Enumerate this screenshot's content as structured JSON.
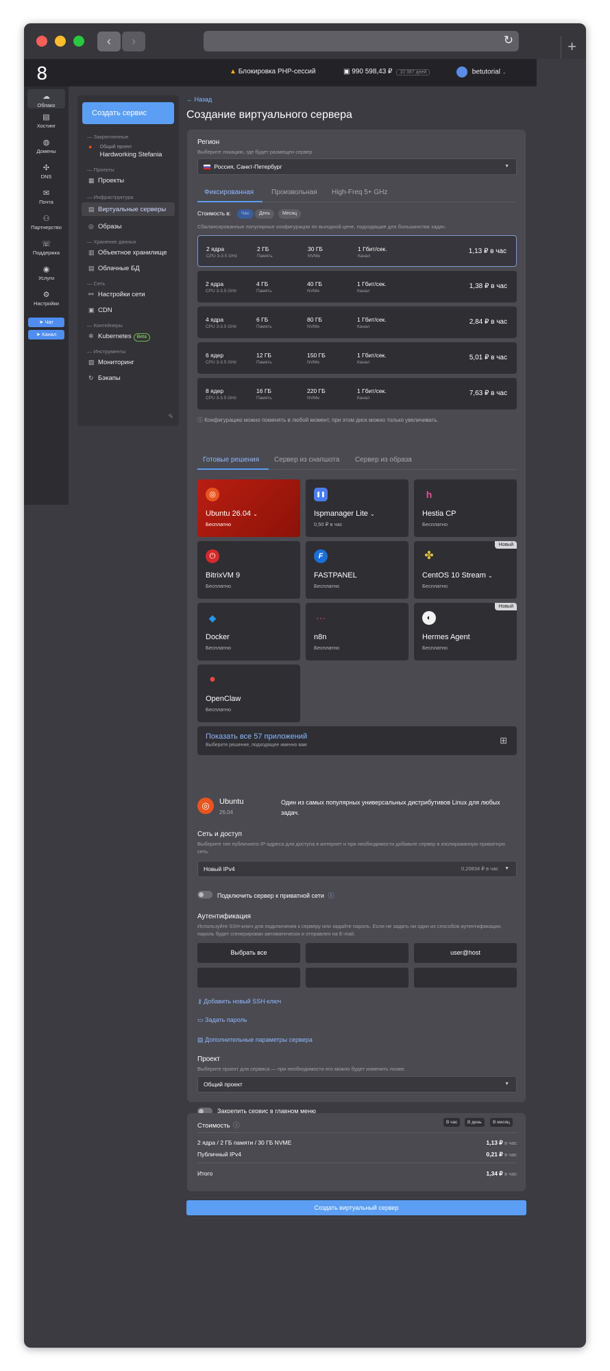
{
  "browser": {
    "back": "‹",
    "forward": "›",
    "reload": "↻",
    "new_tab": "+"
  },
  "header": {
    "logo": "8",
    "notice": "Блокировка PHP-сессий",
    "balance": "990 598,43 ₽",
    "balance_badge": "10 387 дней",
    "user": "betutorial"
  },
  "left_nav": [
    {
      "label": "Облако",
      "icon": "cloud-icon",
      "glyph": "☁"
    },
    {
      "label": "Хостинг",
      "icon": "server-icon",
      "glyph": "▤"
    },
    {
      "label": "Домены",
      "icon": "globe-icon",
      "glyph": "◍"
    },
    {
      "label": "DNS",
      "icon": "dns-icon",
      "glyph": "✣"
    },
    {
      "label": "Почта",
      "icon": "mail-icon",
      "glyph": "✉"
    },
    {
      "label": "Партнерство",
      "icon": "partner-icon",
      "glyph": "⚇"
    },
    {
      "label": "Поддержка",
      "icon": "support-icon",
      "glyph": "☏"
    },
    {
      "label": "Услуги",
      "icon": "services-icon",
      "glyph": "◉"
    },
    {
      "label": "Настройки",
      "icon": "gear-icon",
      "glyph": "⚙"
    }
  ],
  "pills": {
    "chat": "Чат",
    "channel": "Канал"
  },
  "menu": {
    "create_button": "Создать сервис",
    "pinned": "Закрепленные",
    "project_small": "Общий проект",
    "project_name": "Hardworking Stefania",
    "projects_section": "Проекты",
    "projects": "Проекты",
    "infra": "Инфраструктура",
    "vds": "Виртуальные серверы",
    "images": "Образы",
    "storage_section": "Хранение данных",
    "object_storage": "Объектное хранилище",
    "cloud_db": "Облачные БД",
    "network_section": "Сеть",
    "network_settings": "Настройки сети",
    "cdn": "CDN",
    "containers": "Контейнеры",
    "kubernetes": "Kubernetes",
    "beta": "Beta",
    "tools": "Инструменты",
    "monitoring": "Мониторинг",
    "backups": "Бэкапы"
  },
  "page": {
    "back": "← Назад",
    "title": "Создание виртуального сервера"
  },
  "region": {
    "label": "Регион",
    "hint": "Выберите локацию, где будет размещен сервер",
    "value": "Россия, Санкт-Петербург"
  },
  "config_tabs": [
    "Фиксированная",
    "Произвольная",
    "High-Freq 5+ GHz"
  ],
  "cost_switch": {
    "label": "Стоимость в:",
    "options": [
      "Час",
      "День",
      "Месяц"
    ]
  },
  "config_hint": "Сбалансированные популярные конфигурации по выгодной цене, подходящие для большинства задач.",
  "configs": [
    {
      "cpu": "2 ядра",
      "cpu_sub": "CPU 3-3.5 GHz",
      "ram": "2 ГБ",
      "ram_sub": "Память",
      "disk": "30 ГБ",
      "disk_sub": "NVMe",
      "net": "1 Гбит/сек.",
      "net_sub": "Канал",
      "price": "1,13 ₽ в час"
    },
    {
      "cpu": "2 ядра",
      "cpu_sub": "CPU 3-3.5 GHz",
      "ram": "4 ГБ",
      "ram_sub": "Память",
      "disk": "40 ГБ",
      "disk_sub": "NVMe",
      "net": "1 Гбит/сек.",
      "net_sub": "Канал",
      "price": "1,38 ₽ в час"
    },
    {
      "cpu": "4 ядра",
      "cpu_sub": "CPU 3-3.5 GHz",
      "ram": "6 ГБ",
      "ram_sub": "Память",
      "disk": "80 ГБ",
      "disk_sub": "NVMe",
      "net": "1 Гбит/сек.",
      "net_sub": "Канал",
      "price": "2,84 ₽ в час"
    },
    {
      "cpu": "6 ядер",
      "cpu_sub": "CPU 3-3.5 GHz",
      "ram": "12 ГБ",
      "ram_sub": "Память",
      "disk": "150 ГБ",
      "disk_sub": "NVMe",
      "net": "1 Гбит/сек.",
      "net_sub": "Канал",
      "price": "5,01 ₽ в час"
    },
    {
      "cpu": "8 ядер",
      "cpu_sub": "CPU 3-3.5 GHz",
      "ram": "16 ГБ",
      "ram_sub": "Память",
      "disk": "220 ГБ",
      "disk_sub": "NVMe",
      "net": "1 Гбит/сек.",
      "net_sub": "Канал",
      "price": "7,63 ₽ в час"
    }
  ],
  "config_note": "ⓘ  Конфигурацию можно поменять в любой момент, при этом диск можно только увеличивать.",
  "os_tabs": [
    "Готовые решения",
    "Сервер из снапшота",
    "Сервер из образа"
  ],
  "apps": [
    {
      "name": "Ubuntu 26.04",
      "price": "Бесплатно",
      "icon": "ubuntu-icon",
      "glyph": "◎",
      "color": "#e95420",
      "chev": true
    },
    {
      "name": "Ispmanager Lite",
      "price": "0,50 ₽ в час",
      "icon": "ispmanager-icon",
      "glyph": "❚❚",
      "color": "#4a7df0",
      "chev": true
    },
    {
      "name": "Hestia CP",
      "price": "Бесплатно",
      "icon": "hestia-icon",
      "glyph": "h",
      "color": "#2e2e33",
      "chev": false
    },
    {
      "name": "BitrixVM 9",
      "price": "Бесплатно",
      "icon": "bitrix-icon",
      "glyph": "⏻",
      "color": "#d42a2a",
      "chev": false
    },
    {
      "name": "FASTPANEL",
      "price": "Бесплатно",
      "icon": "fastpanel-icon",
      "glyph": "F",
      "color": "#1a6fd8",
      "chev": false
    },
    {
      "name": "CentOS 10 Stream",
      "price": "Бесплатно",
      "icon": "centos-icon",
      "glyph": "✤",
      "color": "#9b4aa6",
      "chev": true,
      "badge": "Новый"
    },
    {
      "name": "Docker",
      "price": "Бесплатно",
      "icon": "docker-icon",
      "glyph": "🐳",
      "color": "#2e2e33",
      "chev": false
    },
    {
      "name": "n8n",
      "price": "Бесплатно",
      "icon": "n8n-icon",
      "glyph": "⋯",
      "color": "#2e2e33",
      "chev": false
    },
    {
      "name": "Hermes Agent",
      "price": "Бесплатно",
      "icon": "hermes-icon",
      "glyph": "◐",
      "color": "#f2f2f2",
      "chev": false,
      "badge": "Новый"
    },
    {
      "name": "OpenClaw",
      "price": "Бесплатно",
      "icon": "openclaw-icon",
      "glyph": "●",
      "color": "#e64a3a",
      "chev": false
    }
  ],
  "show_all": {
    "title": "Показать все 57 приложений",
    "sub": "Выберите решение, подходящее именно вам"
  },
  "selected_os": {
    "name": "Ubuntu",
    "version": "26.04",
    "desc": "Один из самых популярных универсальных дистрибутивов Linux для любых задач."
  },
  "network": {
    "label": "Сеть и доступ",
    "hint": "Выберите тип публичного IP-адреса для доступа в интернет и при необходимости добавьте сервер в изолированную приватную сеть.",
    "value": "Новый IPv4",
    "price": "0,20834 ₽ в час",
    "private": "Подключить сервер к приватной сети"
  },
  "auth": {
    "label": "Аутентификация",
    "hint": "Используйте SSH-ключ для подключения к серверу или задайте пароль. Если не задать ни один из способов аутентификации, пароль будет сгенерирован автоматически и отправлен на E-mail.",
    "select_all": "Выбрать все",
    "key": "user@host",
    "add_key": "Добавить новый SSH-ключ",
    "set_password": "Задать пароль",
    "extra": "Дополнительные параметры сервера"
  },
  "project": {
    "label": "Проект",
    "hint": "Выберите проект для сервиса — при необходимости его можно будет изменить позже.",
    "value": "Общий проект",
    "pin": "Закрепить сервис в главном меню"
  },
  "cost": {
    "label": "Стоимость",
    "periods": [
      "В час",
      "В день",
      "В месяц"
    ],
    "rows": [
      {
        "name": "2 ядра / 2 ГБ памяти / 30 ГБ NVME",
        "value": "1,13 ₽",
        "unit": "в час"
      },
      {
        "name": "Публичный IPv4",
        "value": "0,21 ₽",
        "unit": "в час"
      }
    ],
    "total_label": "Итого",
    "total_value": "1,34 ₽",
    "total_unit": "в час"
  },
  "submit": "Создать виртуальный сервер"
}
